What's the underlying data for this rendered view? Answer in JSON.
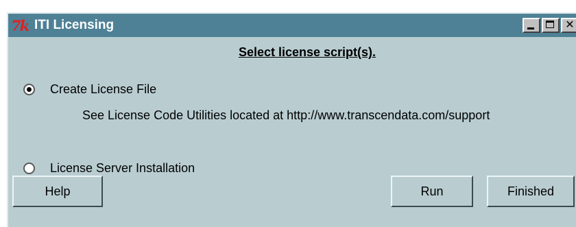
{
  "window": {
    "title": "ITI Licensing",
    "app_icon_text": "7k"
  },
  "heading": "Select license script(s).",
  "options": [
    {
      "label": "Create License File",
      "checked": true
    },
    {
      "label": "License Server Installation",
      "checked": false
    }
  ],
  "note": "See License Code Utilities located at http://www.transcendata.com/support",
  "buttons": {
    "help": "Help",
    "run": "Run",
    "finished": "Finished"
  },
  "titlebar_buttons": {
    "close": "✕"
  },
  "colors": {
    "titlebar": "#4e8196",
    "background": "#b9cdd1"
  }
}
